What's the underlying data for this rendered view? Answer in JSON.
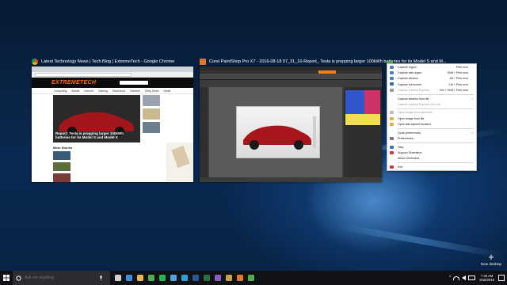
{
  "windows": [
    {
      "app": "chrome",
      "title": "Latest Technology News | Tech Blog | ExtremeTech - Google Chrome",
      "icon": "chrome-icon"
    },
    {
      "app": "paintshop",
      "title": "Corel PaintShop Pro X7 - 2016-08-18 07_31_10-Report_ Tesla is prepping larger 100kWh batteries for its Model S and M...",
      "icon": "paintshop-icon"
    },
    {
      "app": "greenshot",
      "title": "",
      "icon": "greenshot-icon"
    }
  ],
  "chrome_page": {
    "logo": "EXTREMETECH",
    "nav": [
      "Computing",
      "Mobile",
      "Internet",
      "Gaming",
      "Electronics",
      "Extreme",
      "Deep Dives",
      "Deals"
    ],
    "hero_title": "Report: Tesla is prepping larger 100kWh batteries for its Model S and Model X",
    "list_heading": "More Stories"
  },
  "menu": {
    "items": [
      {
        "type": "item",
        "label": "Capture region",
        "shortcut": "Print scrn",
        "icon": "region-icon",
        "color": "#4a7fd0"
      },
      {
        "type": "item",
        "label": "Capture last region",
        "shortcut": "Shift + Print scrn",
        "icon": "last-region-icon",
        "color": "#4a7fd0"
      },
      {
        "type": "item",
        "label": "Capture window",
        "shortcut": "Alt + Print scrn",
        "icon": "window-icon",
        "color": "#4a7fd0"
      },
      {
        "type": "item",
        "label": "Capture full screen",
        "shortcut": "Ctrl + Print scrn",
        "icon": "fullscreen-icon",
        "color": "#2e6db4"
      },
      {
        "type": "item",
        "label": "Capture Internet Explorer",
        "shortcut": "Ctrl + Shift + Print scrn",
        "icon": "ie-icon",
        "color": "#9a9a9a",
        "disabled": true
      },
      {
        "type": "sep"
      },
      {
        "type": "item",
        "label": "Capture window from list",
        "arrow": true
      },
      {
        "type": "item",
        "label": "Capture Internet Explorer from list",
        "arrow": true,
        "disabled": true
      },
      {
        "type": "sep"
      },
      {
        "type": "item",
        "label": "Open image from clipboard",
        "icon": "clipboard-icon",
        "color": "#bbbbbb",
        "disabled": true
      },
      {
        "type": "item",
        "label": "Open image from file",
        "icon": "folder-icon",
        "color": "#e2b33c"
      },
      {
        "type": "item",
        "label": "Open last capture location",
        "icon": "location-icon",
        "color": "#e2b33c"
      },
      {
        "type": "sep"
      },
      {
        "type": "item",
        "label": "Quick preferences",
        "arrow": true
      },
      {
        "type": "item",
        "label": "Preferences...",
        "icon": "settings-icon",
        "color": "#6e7b8b"
      },
      {
        "type": "sep"
      },
      {
        "type": "item",
        "label": "Help",
        "icon": "help-icon",
        "color": "#3a77c9"
      },
      {
        "type": "item",
        "label": "Support Greenshot",
        "icon": "heart-icon",
        "color": "#d8333a"
      },
      {
        "type": "item",
        "label": "About Greenshot"
      },
      {
        "type": "sep"
      },
      {
        "type": "item",
        "label": "Exit",
        "icon": "exit-icon",
        "color": "#d8333a"
      }
    ]
  },
  "new_desktop": {
    "label": "New desktop",
    "icon": "plus-icon"
  },
  "taskbar": {
    "search_placeholder": "Ask me anything",
    "pinned": [
      {
        "name": "task-view-icon",
        "color": "#d0d0d0"
      },
      {
        "name": "edge-icon",
        "color": "#3a8fe0"
      },
      {
        "name": "file-explorer-icon",
        "color": "#e8b84a"
      },
      {
        "name": "chrome-icon",
        "color": "#4caf50"
      },
      {
        "name": "spotify-icon",
        "color": "#1db954"
      },
      {
        "name": "store-icon",
        "color": "#4aa3df"
      },
      {
        "name": "photoshop-icon",
        "color": "#2aa0d8"
      },
      {
        "name": "word-icon",
        "color": "#2b579a"
      },
      {
        "name": "excel-icon",
        "color": "#217346"
      },
      {
        "name": "visual-studio-icon",
        "color": "#865fc5"
      },
      {
        "name": "app-icon",
        "color": "#c8a04a"
      },
      {
        "name": "paintshop-icon",
        "color": "#e07a2a"
      },
      {
        "name": "greenshot-icon",
        "color": "#4cae4c"
      }
    ],
    "time": "7:45 AM",
    "date": "8/18/2016"
  }
}
